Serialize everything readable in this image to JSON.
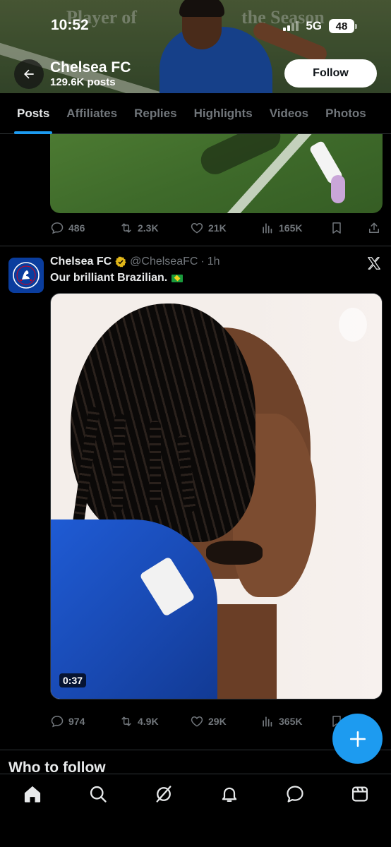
{
  "status_bar": {
    "time": "10:52",
    "network": "5G",
    "battery": "48"
  },
  "banner": {
    "overlay_text_left": "Player of",
    "overlay_text_right": "the Season"
  },
  "profile": {
    "name": "Chelsea FC",
    "posts_count": "129.6K posts",
    "follow_label": "Follow"
  },
  "tabs": [
    {
      "label": "Posts",
      "active": true
    },
    {
      "label": "Affiliates",
      "active": false
    },
    {
      "label": "Replies",
      "active": false
    },
    {
      "label": "Highlights",
      "active": false
    },
    {
      "label": "Videos",
      "active": false
    },
    {
      "label": "Photos",
      "active": false
    }
  ],
  "post1": {
    "stats": {
      "replies": "486",
      "reposts": "2.3K",
      "likes": "21K",
      "views": "165K"
    }
  },
  "post2": {
    "author": "Chelsea FC",
    "handle": "@ChelseaFC",
    "separator": "·",
    "time": "1h",
    "text": "Our brilliant Brazilian.",
    "video_duration": "0:37",
    "stats": {
      "replies": "974",
      "reposts": "4.9K",
      "likes": "29K",
      "views": "365K"
    }
  },
  "who_to_follow": {
    "heading": "Who to follow"
  },
  "colors": {
    "accent": "#1d9bf0",
    "background": "#000000",
    "muted_text": "#71767b",
    "divider": "#2f3336",
    "verified_gold": "#e2b719"
  },
  "icons": {
    "back": "arrow-left-icon",
    "reply": "chat-bubble-icon",
    "repost": "repost-icon",
    "like": "heart-icon",
    "views": "bar-chart-icon",
    "bookmark": "bookmark-icon",
    "share": "share-icon",
    "verified": "verified-badge-icon",
    "x_logo": "x-logo-icon",
    "compose": "plus-icon",
    "nav": [
      "home-icon",
      "search-icon",
      "grok-icon",
      "bell-icon",
      "message-icon",
      "communities-icon"
    ]
  }
}
